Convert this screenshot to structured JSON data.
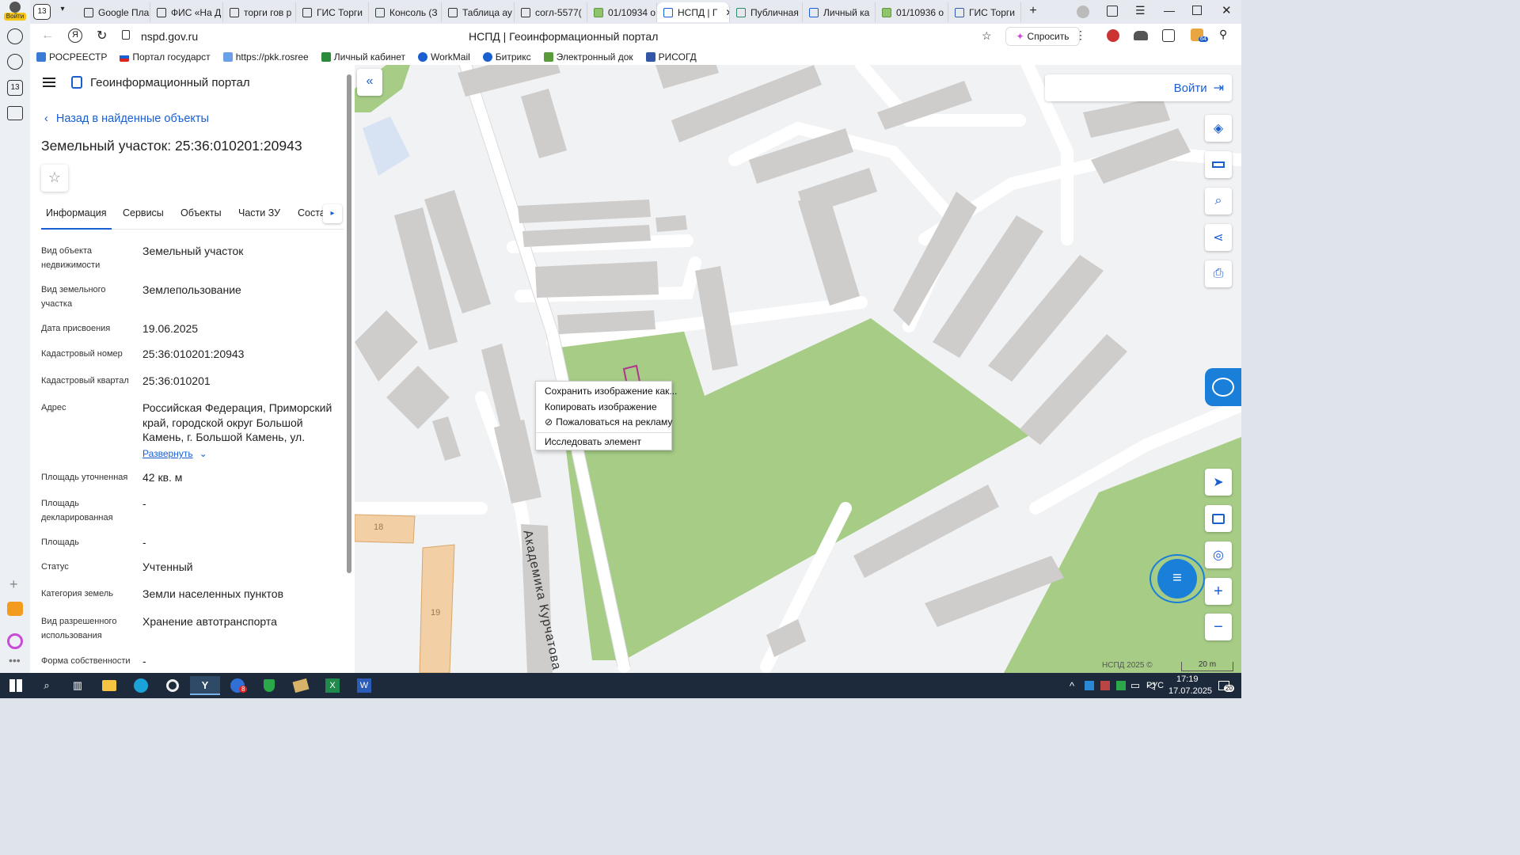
{
  "browser": {
    "tab_count": "13",
    "profile_label": "Войти",
    "tabs": [
      {
        "label": "Google Пла"
      },
      {
        "label": "ФИС «На Д"
      },
      {
        "label": "торги гов р"
      },
      {
        "label": "ГИС Торги"
      },
      {
        "label": "Консоль (З"
      },
      {
        "label": "Таблица ау"
      },
      {
        "label": "согл-5577("
      },
      {
        "label": "01/10934 о"
      },
      {
        "label": "НСПД | Г"
      },
      {
        "label": "Публичная"
      },
      {
        "label": "Личный ка"
      },
      {
        "label": "01/10936 о"
      },
      {
        "label": "ГИС Торги"
      }
    ],
    "url": "nspd.gov.ru",
    "page_title": "НСПД | Геоинформационный портал",
    "ask_label": "Спросить",
    "ext_badge": "64",
    "left_rail_badge": "13",
    "bookmarks": [
      {
        "label": "РОСРЕЕСТР"
      },
      {
        "label": "Портал государст"
      },
      {
        "label": "https://pkk.rosree"
      },
      {
        "label": "Личный кабинет"
      },
      {
        "label": "WorkMail"
      },
      {
        "label": "Битрикс"
      },
      {
        "label": "Электронный док"
      },
      {
        "label": "РИСОГД"
      }
    ]
  },
  "portal": {
    "title": "Геоинформационный портал",
    "back_label": "Назад в найденные объекты",
    "object_title": "Земельный участок: 25:36:010201:20943",
    "tabs": [
      {
        "label": "Информация"
      },
      {
        "label": "Сервисы"
      },
      {
        "label": "Объекты"
      },
      {
        "label": "Части ЗУ"
      },
      {
        "label": "Соста"
      }
    ],
    "fields": [
      {
        "key": "Вид объекта недвижимости",
        "value": "Земельный участок"
      },
      {
        "key": "Вид земельного участка",
        "value": "Землепользование"
      },
      {
        "key": "Дата присвоения",
        "value": "19.06.2025"
      },
      {
        "key": "Кадастровый номер",
        "value": "25:36:010201:20943"
      },
      {
        "key": "Кадастровый квартал",
        "value": "25:36:010201"
      },
      {
        "key": "Адрес",
        "value": "Российская Федерация, Приморский край, городской округ Большой Камень, г. Большой Камень, ул."
      },
      {
        "key": "Площадь уточненная",
        "value": "42 кв. м"
      },
      {
        "key": "Площадь декларированная",
        "value": "-"
      },
      {
        "key": "Площадь",
        "value": "-"
      },
      {
        "key": "Статус",
        "value": "Учтенный"
      },
      {
        "key": "Категория земель",
        "value": "Земли населенных пунктов"
      },
      {
        "key": "Вид разрешенного использования",
        "value": "Хранение автотранспорта"
      },
      {
        "key": "Форма собственности",
        "value": "-"
      }
    ],
    "expand_label": "Развернуть"
  },
  "map": {
    "login_label": "Войти",
    "street_label": "Академика Курчатова",
    "house_18": "18",
    "house_19": "19",
    "copyright": "НСПД 2025 ©",
    "scale": "20 m",
    "context_menu": {
      "save": "Сохранить изображение как...",
      "copy": "Копировать изображение",
      "report": "Пожаловаться на рекламу",
      "inspect": "Исследовать элемент"
    }
  },
  "taskbar": {
    "lang": "РУС",
    "time": "17:19",
    "date": "17.07.2025",
    "notif_count": "20",
    "mail_badge": "8"
  },
  "colors": {
    "accent": "#1a5fd0",
    "green_area": "#a6cc86",
    "building": "#cfcdcb",
    "parcel_orange": "#f2cfa4"
  }
}
